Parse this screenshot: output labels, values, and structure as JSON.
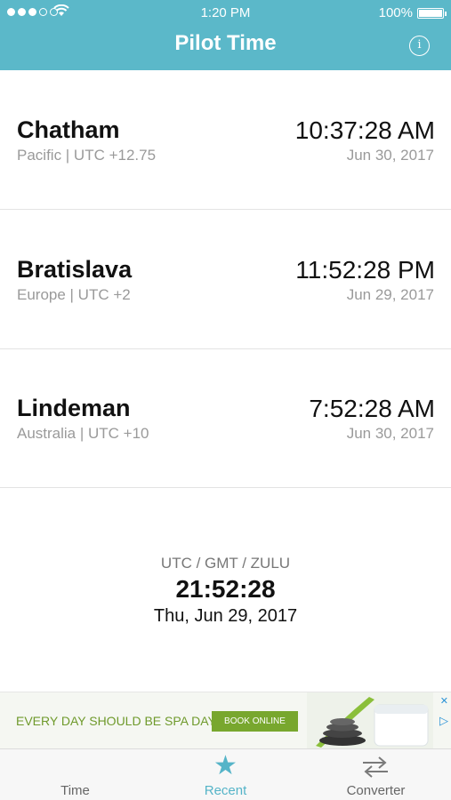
{
  "status": {
    "time": "1:20 PM",
    "battery": "100%"
  },
  "header": {
    "title": "Pilot Time",
    "info_icon": "info-icon"
  },
  "rows": [
    {
      "city": "Chatham",
      "zone": "Pacific | UTC +12.75",
      "time": "10:37:28 AM",
      "date": "Jun 30, 2017"
    },
    {
      "city": "Bratislava",
      "zone": "Europe | UTC +2",
      "time": "11:52:28 PM",
      "date": "Jun 29, 2017"
    },
    {
      "city": "Lindeman",
      "zone": "Australia | UTC +10",
      "time": "7:52:28 AM",
      "date": "Jun 30, 2017"
    }
  ],
  "utc": {
    "label": "UTC / GMT / ZULU",
    "time": "21:52:28",
    "date": "Thu, Jun 29, 2017"
  },
  "ad": {
    "text": "EVERY DAY SHOULD BE SPA DAY.",
    "button": "BOOK ONLINE",
    "choices_icon": "ad-choices-icon",
    "play_icon": "ad-play-icon"
  },
  "tabs": [
    {
      "label": "Time",
      "icon": "clock-icon"
    },
    {
      "label": "Recent",
      "icon": "star-icon"
    },
    {
      "label": "Converter",
      "icon": "swap-arrows-icon"
    }
  ],
  "colors": {
    "header": "#5bb8c9",
    "accent": "#55b4c8",
    "ad_green": "#78a72e"
  }
}
